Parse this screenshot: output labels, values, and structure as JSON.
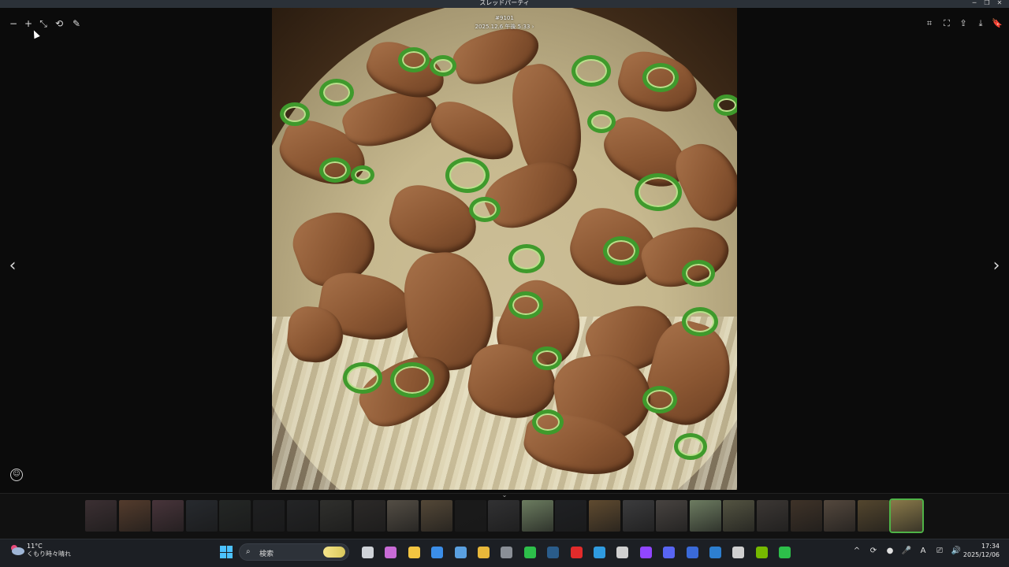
{
  "window": {
    "title": "スレッドパーティ",
    "controls": [
      "─",
      "❐",
      "✕"
    ]
  },
  "toolbar_left": [
    {
      "name": "zoom-out-icon",
      "glyph": "−"
    },
    {
      "name": "zoom-in-icon",
      "glyph": "+"
    },
    {
      "name": "fit-icon",
      "glyph": "⤡"
    },
    {
      "name": "rotate-icon",
      "glyph": "⟲"
    },
    {
      "name": "edit-icon",
      "glyph": "✎"
    }
  ],
  "toolbar_right": [
    {
      "name": "scan-icon",
      "glyph": "⌗"
    },
    {
      "name": "fullscreen-icon",
      "glyph": "⛶"
    },
    {
      "name": "share-icon",
      "glyph": "⇪"
    },
    {
      "name": "download-icon",
      "glyph": "⤓"
    },
    {
      "name": "bookmark-icon",
      "glyph": "🔖"
    }
  ],
  "photo": {
    "title": "#9101",
    "timestamp": "2025.12.6 午後 5:33 ›"
  },
  "nav": {
    "prev": "‹",
    "next": "›"
  },
  "emoji_button": "☺",
  "filmstrip": {
    "collapse": "⌄",
    "thumbnails": [
      {
        "color": "#4a3a3e"
      },
      {
        "color": "#6a4a36"
      },
      {
        "color": "#5a4048"
      },
      {
        "color": "#2e3238"
      },
      {
        "color": "#2a2e2c"
      },
      {
        "color": "#232426"
      },
      {
        "color": "#2a2b2d"
      },
      {
        "color": "#3a3a36"
      },
      {
        "color": "#353230"
      },
      {
        "color": "#6a6256"
      },
      {
        "color": "#6a5a44"
      },
      {
        "color": "#1e1e1e"
      },
      {
        "color": "#3c3c3e"
      },
      {
        "color": "#8aa07a"
      },
      {
        "color": "#24262a"
      },
      {
        "color": "#7a5e3a"
      },
      {
        "color": "#4a4a4c"
      },
      {
        "color": "#5a5450"
      },
      {
        "color": "#8ca07c"
      },
      {
        "color": "#6a6a52"
      },
      {
        "color": "#4a4440"
      },
      {
        "color": "#4e3e30"
      },
      {
        "color": "#6a5a4c"
      },
      {
        "color": "#6a5838"
      },
      {
        "color": "#8a7a4a",
        "active": true
      }
    ]
  },
  "taskbar": {
    "weather_temp": "11°C",
    "weather_desc": "くもり時々晴れ",
    "search_label": "検索",
    "pinned": [
      {
        "name": "task-view-icon",
        "color": "#cfd3d8"
      },
      {
        "name": "copilot-icon",
        "color": "#c86bd6"
      },
      {
        "name": "file-explorer-icon",
        "color": "#f3c541"
      },
      {
        "name": "store-icon",
        "color": "#3b8ee8"
      },
      {
        "name": "photos-icon",
        "color": "#5aa0e0"
      },
      {
        "name": "chrome-icon",
        "color": "#e8b83a"
      },
      {
        "name": "calculator-icon",
        "color": "#8a8f96"
      },
      {
        "name": "line-icon",
        "color": "#2dbf4a"
      },
      {
        "name": "steam-icon",
        "color": "#2a5c8a"
      },
      {
        "name": "youtube-icon",
        "color": "#e22b2b"
      },
      {
        "name": "edge-icon",
        "color": "#2f9be0"
      },
      {
        "name": "threads-icon",
        "color": "#d0d0d0"
      },
      {
        "name": "twitch-icon",
        "color": "#9146ff"
      },
      {
        "name": "discord-icon",
        "color": "#5865f2"
      },
      {
        "name": "app-icon",
        "color": "#3a6ad8"
      },
      {
        "name": "remote-icon",
        "color": "#2d7fd0"
      },
      {
        "name": "g-app-icon",
        "color": "#d0d0d0"
      },
      {
        "name": "nvidia-icon",
        "color": "#76b900"
      },
      {
        "name": "line-app-icon",
        "color": "#2dbf4a"
      }
    ],
    "tray": [
      "^",
      "⟳",
      "●",
      "🎤",
      "A",
      "⎚",
      "🔊"
    ],
    "time": "17:34",
    "date": "2025/12/06"
  }
}
